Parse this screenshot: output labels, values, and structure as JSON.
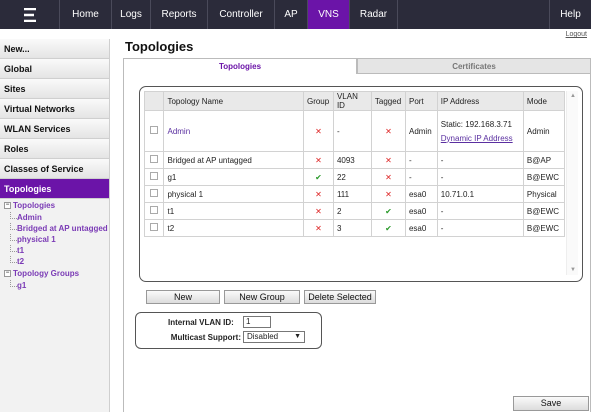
{
  "topbar": {
    "logo_icon": "extreme-logo-icon",
    "nav": [
      {
        "label": "Home",
        "active": false
      },
      {
        "label": "Logs",
        "active": false
      },
      {
        "label": "Reports",
        "active": false
      },
      {
        "label": "Controller",
        "active": false
      },
      {
        "label": "AP",
        "active": false
      },
      {
        "label": "VNS",
        "active": true
      },
      {
        "label": "Radar",
        "active": false
      }
    ],
    "help": "Help",
    "logout": "Logout",
    "accent": "#6b14a8"
  },
  "sidebar": {
    "items": [
      {
        "label": "New..."
      },
      {
        "label": "Global"
      },
      {
        "label": "Sites"
      },
      {
        "label": "Virtual Networks"
      },
      {
        "label": "WLAN Services"
      },
      {
        "label": "Roles"
      },
      {
        "label": "Classes of Service"
      },
      {
        "label": "Topologies",
        "active": true
      }
    ],
    "tree": {
      "topologies_label": "Topologies",
      "topologies": [
        "Admin",
        "Bridged at AP untagged",
        "physical 1",
        "t1",
        "t2"
      ],
      "groups_label": "Topology Groups",
      "groups": [
        "g1"
      ]
    }
  },
  "main": {
    "title": "Topologies",
    "tabs": [
      {
        "label": "Topologies",
        "active": true
      },
      {
        "label": "Certificates",
        "active": false
      }
    ],
    "table": {
      "columns": [
        "",
        "Topology Name",
        "Group",
        "VLAN ID",
        "Tagged",
        "Port",
        "IP Address",
        "Mode"
      ],
      "rows": [
        {
          "name": "Admin",
          "group": "✕",
          "vlan": "-",
          "tagged": "✕",
          "port": "Admin",
          "ip": "Static: 192.168.3.71",
          "ip_link": "Dynamic IP Address",
          "mode": "Admin"
        },
        {
          "name": "Bridged at AP untagged",
          "group": "✕",
          "vlan": "4093",
          "tagged": "✕",
          "port": "-",
          "ip": "-",
          "mode": "B@AP"
        },
        {
          "name": "g1",
          "group": "✔",
          "vlan": "22",
          "tagged": "✕",
          "port": "-",
          "ip": "-",
          "mode": "B@EWC"
        },
        {
          "name": "physical 1",
          "group": "✕",
          "vlan": "111",
          "tagged": "✕",
          "port": "esa0",
          "ip": "10.71.0.1",
          "mode": "Physical"
        },
        {
          "name": "t1",
          "group": "✕",
          "vlan": "2",
          "tagged": "✔",
          "port": "esa0",
          "ip": "-",
          "mode": "B@EWC"
        },
        {
          "name": "t2",
          "group": "✕",
          "vlan": "3",
          "tagged": "✔",
          "port": "esa0",
          "ip": "-",
          "mode": "B@EWC"
        }
      ]
    },
    "buttons": {
      "new": "New",
      "new_group": "New Group",
      "delete_selected": "Delete Selected",
      "save": "Save"
    },
    "form": {
      "internal_vlan_label": "Internal VLAN ID:",
      "internal_vlan_value": "1",
      "multicast_label": "Multicast Support:",
      "multicast_value": "Disabled"
    }
  }
}
